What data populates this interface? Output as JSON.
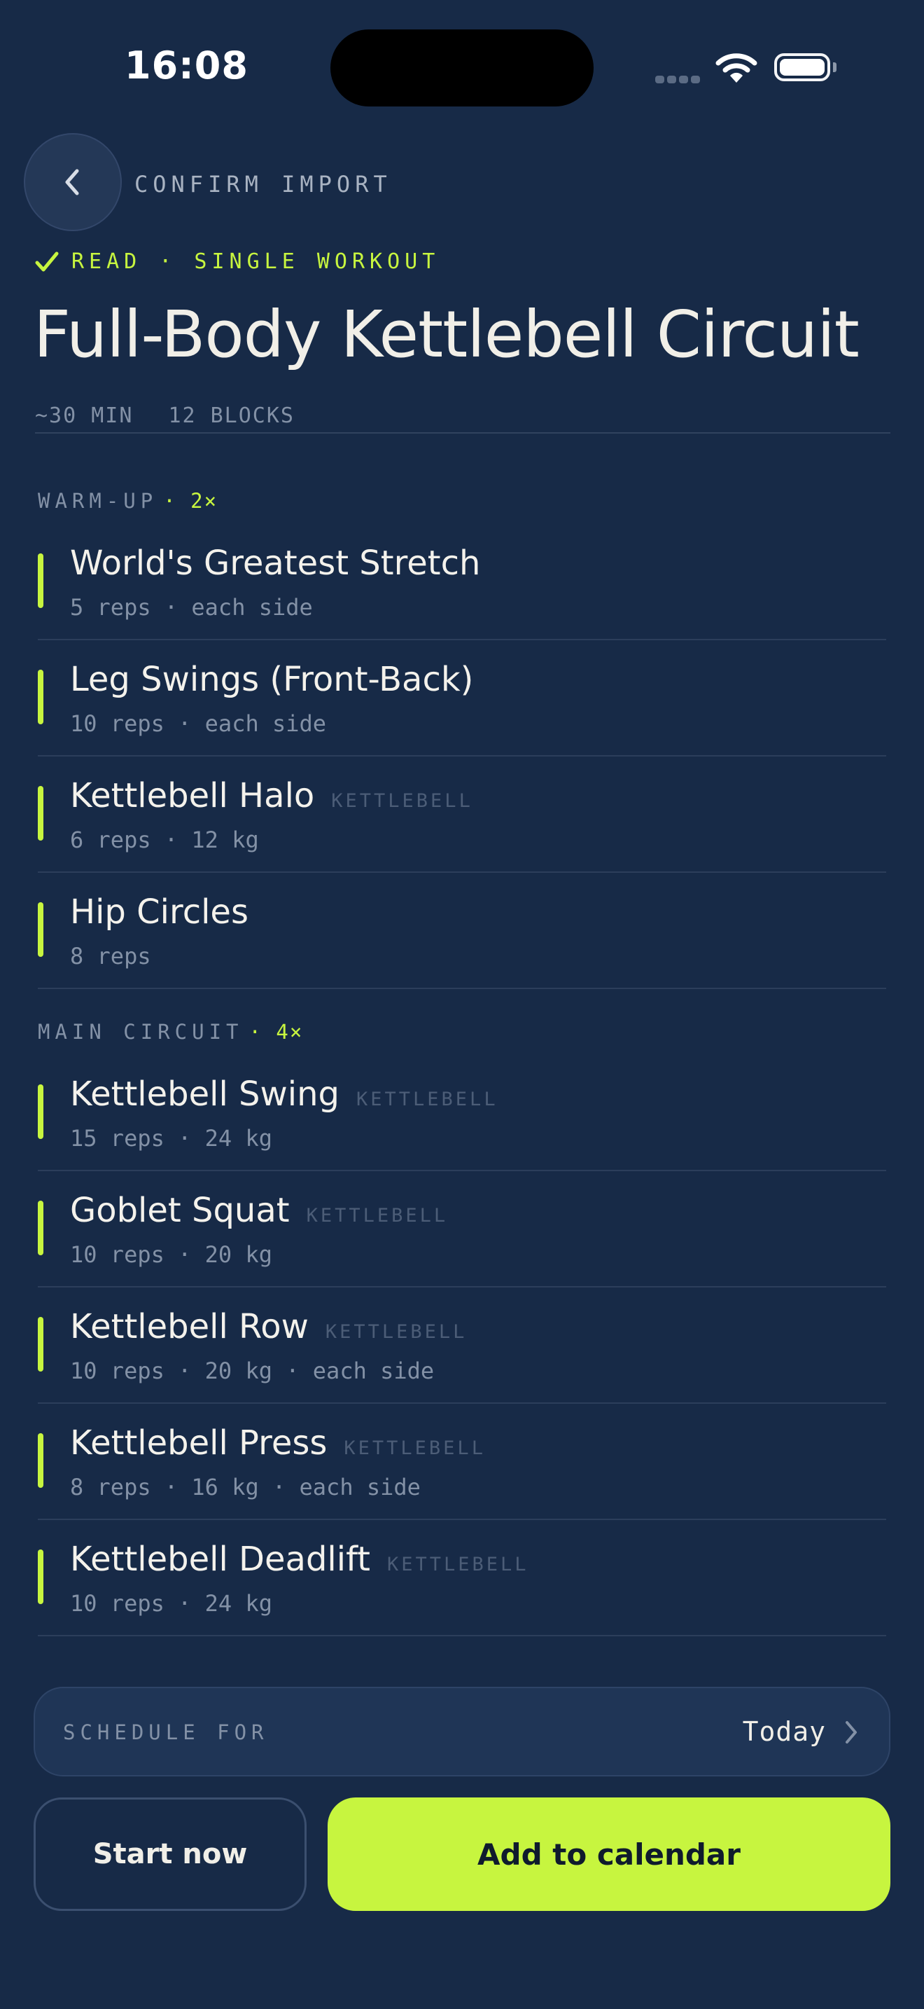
{
  "status_bar": {
    "time": "16:08"
  },
  "header": {
    "title": "CONFIRM IMPORT"
  },
  "badge": {
    "text": "READ · SINGLE WORKOUT"
  },
  "workout": {
    "title": "Full-Body Kettlebell Circuit",
    "duration": "~30 MIN",
    "blocks": "12 BLOCKS"
  },
  "sections": [
    {
      "title": "WARM-UP",
      "multiplier": "· 2×",
      "items": [
        {
          "name": "World's Greatest Stretch",
          "tag": "",
          "detail": "5 reps · each side"
        },
        {
          "name": "Leg Swings (Front-Back)",
          "tag": "",
          "detail": "10 reps · each side"
        },
        {
          "name": "Kettlebell Halo",
          "tag": "KETTLEBELL",
          "detail": "6 reps · 12 kg"
        },
        {
          "name": "Hip Circles",
          "tag": "",
          "detail": "8 reps"
        }
      ]
    },
    {
      "title": "MAIN CIRCUIT",
      "multiplier": "· 4×",
      "items": [
        {
          "name": "Kettlebell Swing",
          "tag": "KETTLEBELL",
          "detail": "15 reps · 24 kg"
        },
        {
          "name": "Goblet Squat",
          "tag": "KETTLEBELL",
          "detail": "10 reps · 20 kg"
        },
        {
          "name": "Kettlebell Row",
          "tag": "KETTLEBELL",
          "detail": "10 reps · 20 kg · each side"
        },
        {
          "name": "Kettlebell Press",
          "tag": "KETTLEBELL",
          "detail": "8 reps · 16 kg · each side"
        },
        {
          "name": "Kettlebell Deadlift",
          "tag": "KETTLEBELL",
          "detail": "10 reps · 24 kg"
        }
      ]
    }
  ],
  "schedule": {
    "label": "SCHEDULE FOR",
    "value": "Today"
  },
  "actions": {
    "start_label": "Start now",
    "add_label": "Add to calendar"
  },
  "colors": {
    "background": "#172a47",
    "accent": "#c7f53f",
    "muted": "#8391a6"
  }
}
